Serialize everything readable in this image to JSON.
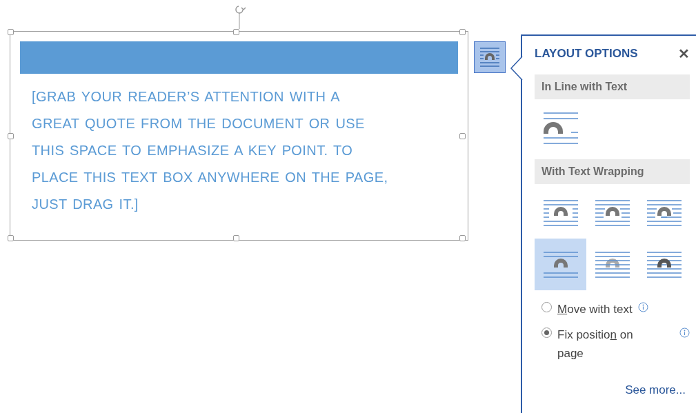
{
  "text_box": {
    "quote_lines": [
      "[GRAB YOUR READER’S ATTENTION WITH A",
      "GREAT QUOTE FROM THE DOCUMENT OR USE",
      "THIS SPACE TO EMPHASIZE A KEY POINT. TO",
      "PLACE THIS TEXT BOX ANYWHERE ON THE PAGE,",
      "JUST DRAG IT.]"
    ]
  },
  "layout_options_button": {
    "selected": true
  },
  "panel": {
    "title": "LAYOUT OPTIONS",
    "close": "✕",
    "inline_section": {
      "heading": "In Line with Text",
      "options": [
        {
          "kind": "inline",
          "selected": false
        }
      ]
    },
    "wrap_section": {
      "heading": "With Text Wrapping",
      "options": [
        {
          "kind": "square",
          "selected": false
        },
        {
          "kind": "tight",
          "selected": false
        },
        {
          "kind": "through",
          "selected": false
        },
        {
          "kind": "top-bottom",
          "selected": true
        },
        {
          "kind": "behind",
          "selected": false
        },
        {
          "kind": "front",
          "selected": false
        }
      ]
    },
    "position": [
      {
        "access_key": "M",
        "label_end": "ove with text",
        "selected": false
      },
      {
        "label_start": "Fix positio",
        "access_key": "n",
        "label_end": " on page",
        "selected": true
      }
    ],
    "see_more": "See more..."
  }
}
